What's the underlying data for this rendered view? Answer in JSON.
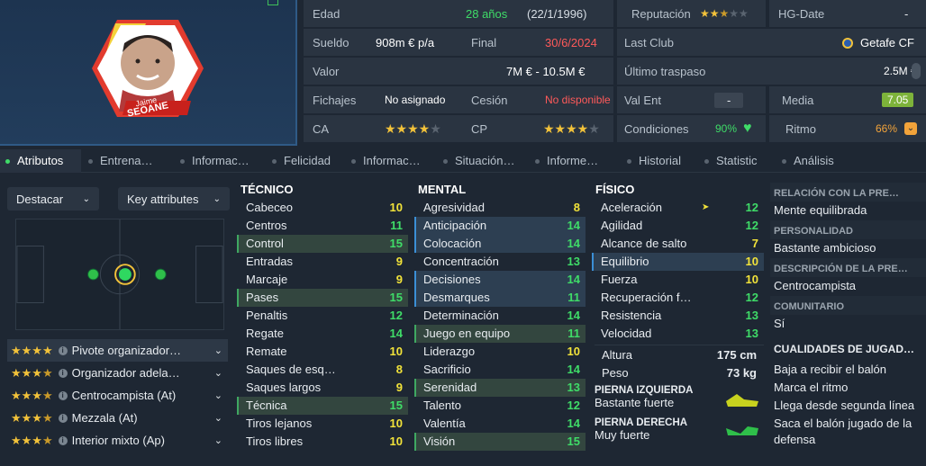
{
  "player": {
    "first_name": "Jaime",
    "last_name": "SEOANE"
  },
  "info": {
    "edad_label": "Edad",
    "edad_value": "28 años",
    "edad_birth": "(22/1/1996)",
    "sueldo_label": "Sueldo",
    "sueldo_value": "908m € p/a",
    "final_label": "Final",
    "final_value": "30/6/2024",
    "valor_label": "Valor",
    "valor_value": "7M € - 10.5M €",
    "fichajes_label": "Fichajes",
    "fichajes_value": "No asignado",
    "cesion_label": "Cesión",
    "cesion_value": "No disponible",
    "ca_label": "CA",
    "ca_stars": 4,
    "cp_label": "CP",
    "cp_stars": 4,
    "reputacion_label": "Reputación",
    "reputacion_stars": 2.5,
    "hgdate_label": "HG-Date",
    "hgdate_value": "-",
    "lastclub_label": "Last Club",
    "lastclub_value": "Getafe CF",
    "traspaso_label": "Último traspaso",
    "traspaso_value": "2.5M €",
    "valent_label": "Val Ent",
    "valent_value": "-",
    "media_label": "Media",
    "media_value": "7.05",
    "condiciones_label": "Condiciones",
    "condiciones_value": "90%",
    "ritmo_label": "Ritmo",
    "ritmo_value": "66%"
  },
  "tabs": [
    "Atributos",
    "Entrena…",
    "Informac…",
    "Felicidad",
    "Informac…",
    "Situación…",
    "Informe…",
    "Historial",
    "Statistic",
    "Análisis"
  ],
  "controls": {
    "destacar": "Destacar",
    "key_attributes": "Key attributes"
  },
  "roles": [
    {
      "stars": 4,
      "label": "Pivote organizador…"
    },
    {
      "stars": 3.5,
      "label": "Organizador adela…"
    },
    {
      "stars": 3.5,
      "label": "Centrocampista (At)"
    },
    {
      "stars": 3.5,
      "label": "Mezzala (At)"
    },
    {
      "stars": 3.5,
      "label": "Interior mixto (Ap)"
    }
  ],
  "tecnico": {
    "title": "TÉCNICO",
    "rows": [
      {
        "name": "Cabeceo",
        "value": "10"
      },
      {
        "name": "Centros",
        "value": "11"
      },
      {
        "name": "Control",
        "value": "15"
      },
      {
        "name": "Entradas",
        "value": "9"
      },
      {
        "name": "Marcaje",
        "value": "9"
      },
      {
        "name": "Pases",
        "value": "15"
      },
      {
        "name": "Penaltis",
        "value": "12"
      },
      {
        "name": "Regate",
        "value": "14"
      },
      {
        "name": "Remate",
        "value": "10"
      },
      {
        "name": "Saques de esq…",
        "value": "8"
      },
      {
        "name": "Saques largos",
        "value": "9"
      },
      {
        "name": "Técnica",
        "value": "15"
      },
      {
        "name": "Tiros lejanos",
        "value": "10"
      },
      {
        "name": "Tiros libres",
        "value": "10"
      }
    ]
  },
  "mental": {
    "title": "MENTAL",
    "rows": [
      {
        "name": "Agresividad",
        "value": "8"
      },
      {
        "name": "Anticipación",
        "value": "14"
      },
      {
        "name": "Colocación",
        "value": "14"
      },
      {
        "name": "Concentración",
        "value": "13"
      },
      {
        "name": "Decisiones",
        "value": "14"
      },
      {
        "name": "Desmarques",
        "value": "11"
      },
      {
        "name": "Determinación",
        "value": "14"
      },
      {
        "name": "Juego en equipo",
        "value": "11"
      },
      {
        "name": "Liderazgo",
        "value": "10"
      },
      {
        "name": "Sacrificio",
        "value": "14"
      },
      {
        "name": "Serenidad",
        "value": "13"
      },
      {
        "name": "Talento",
        "value": "12"
      },
      {
        "name": "Valentía",
        "value": "14"
      },
      {
        "name": "Visión",
        "value": "15"
      }
    ]
  },
  "fisico": {
    "title": "FÍSICO",
    "rows": [
      {
        "name": "Aceleración",
        "value": "12"
      },
      {
        "name": "Agilidad",
        "value": "12"
      },
      {
        "name": "Alcance de salto",
        "value": "7"
      },
      {
        "name": "Equilibrio",
        "value": "10"
      },
      {
        "name": "Fuerza",
        "value": "10"
      },
      {
        "name": "Recuperación f…",
        "value": "12"
      },
      {
        "name": "Resistencia",
        "value": "13"
      },
      {
        "name": "Velocidad",
        "value": "13"
      }
    ],
    "altura_label": "Altura",
    "altura_value": "175 cm",
    "peso_label": "Peso",
    "peso_value": "73 kg",
    "pie_izq_label": "PIERNA IZQUIERDA",
    "pie_izq_value": "Bastante fuerte",
    "pie_der_label": "PIERNA DERECHA",
    "pie_der_value": "Muy fuerte"
  },
  "right": {
    "relacion_title": "RELACIÓN CON LA PRE…",
    "relacion_value": "Mente equilibrada",
    "personalidad_title": "PERSONALIDAD",
    "personalidad_value": "Bastante ambicioso",
    "descripcion_title": "DESCRIPCIÓN DE LA PRE…",
    "descripcion_value": "Centrocampista",
    "comunitario_title": "COMUNITARIO",
    "comunitario_value": "Sí",
    "cualidades_title": "CUALIDADES DE JUGAD…",
    "cualidades": [
      "Baja a recibir el balón",
      "Marca el ritmo",
      "Llega desde segunda línea",
      "Saca el balón jugado de la defensa"
    ]
  },
  "colors": {
    "yellow": "#f2e33a",
    "green": "#3fdc68",
    "orange": "#f2a33a",
    "red": "#ff5a5a",
    "star": "#f2c23a"
  }
}
